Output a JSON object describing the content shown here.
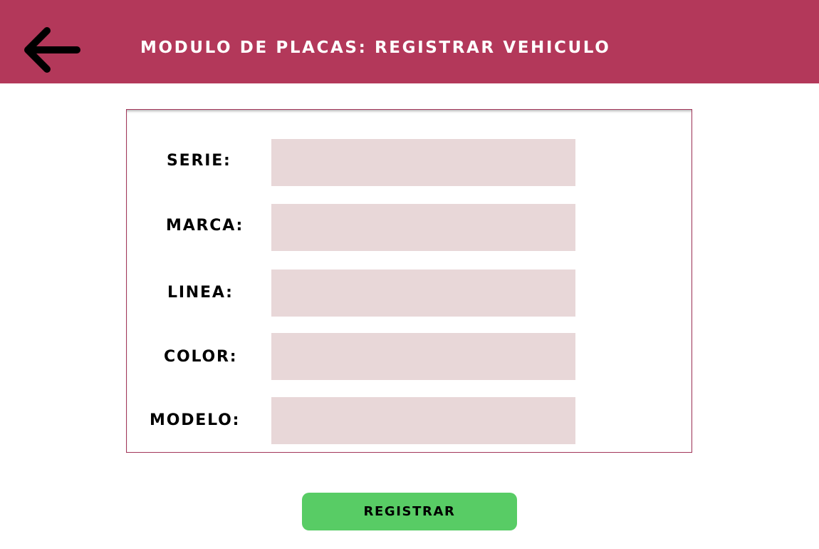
{
  "header": {
    "title": "MODULO DE PLACAS: REGISTRAR VEHICULO",
    "back_icon": "arrow-left-icon",
    "background_color": "#b3385a"
  },
  "form": {
    "fields": [
      {
        "label": "SERIE:",
        "value": "",
        "placeholder": ""
      },
      {
        "label": "MARCA:",
        "value": "",
        "placeholder": ""
      },
      {
        "label": "LINEA:",
        "value": "",
        "placeholder": ""
      },
      {
        "label": "COLOR:",
        "value": "",
        "placeholder": ""
      },
      {
        "label": "MODELO:",
        "value": "",
        "placeholder": ""
      }
    ],
    "input_color": "#e8d7d8"
  },
  "actions": {
    "register_label": "REGISTRAR",
    "register_color": "#58cc65"
  }
}
